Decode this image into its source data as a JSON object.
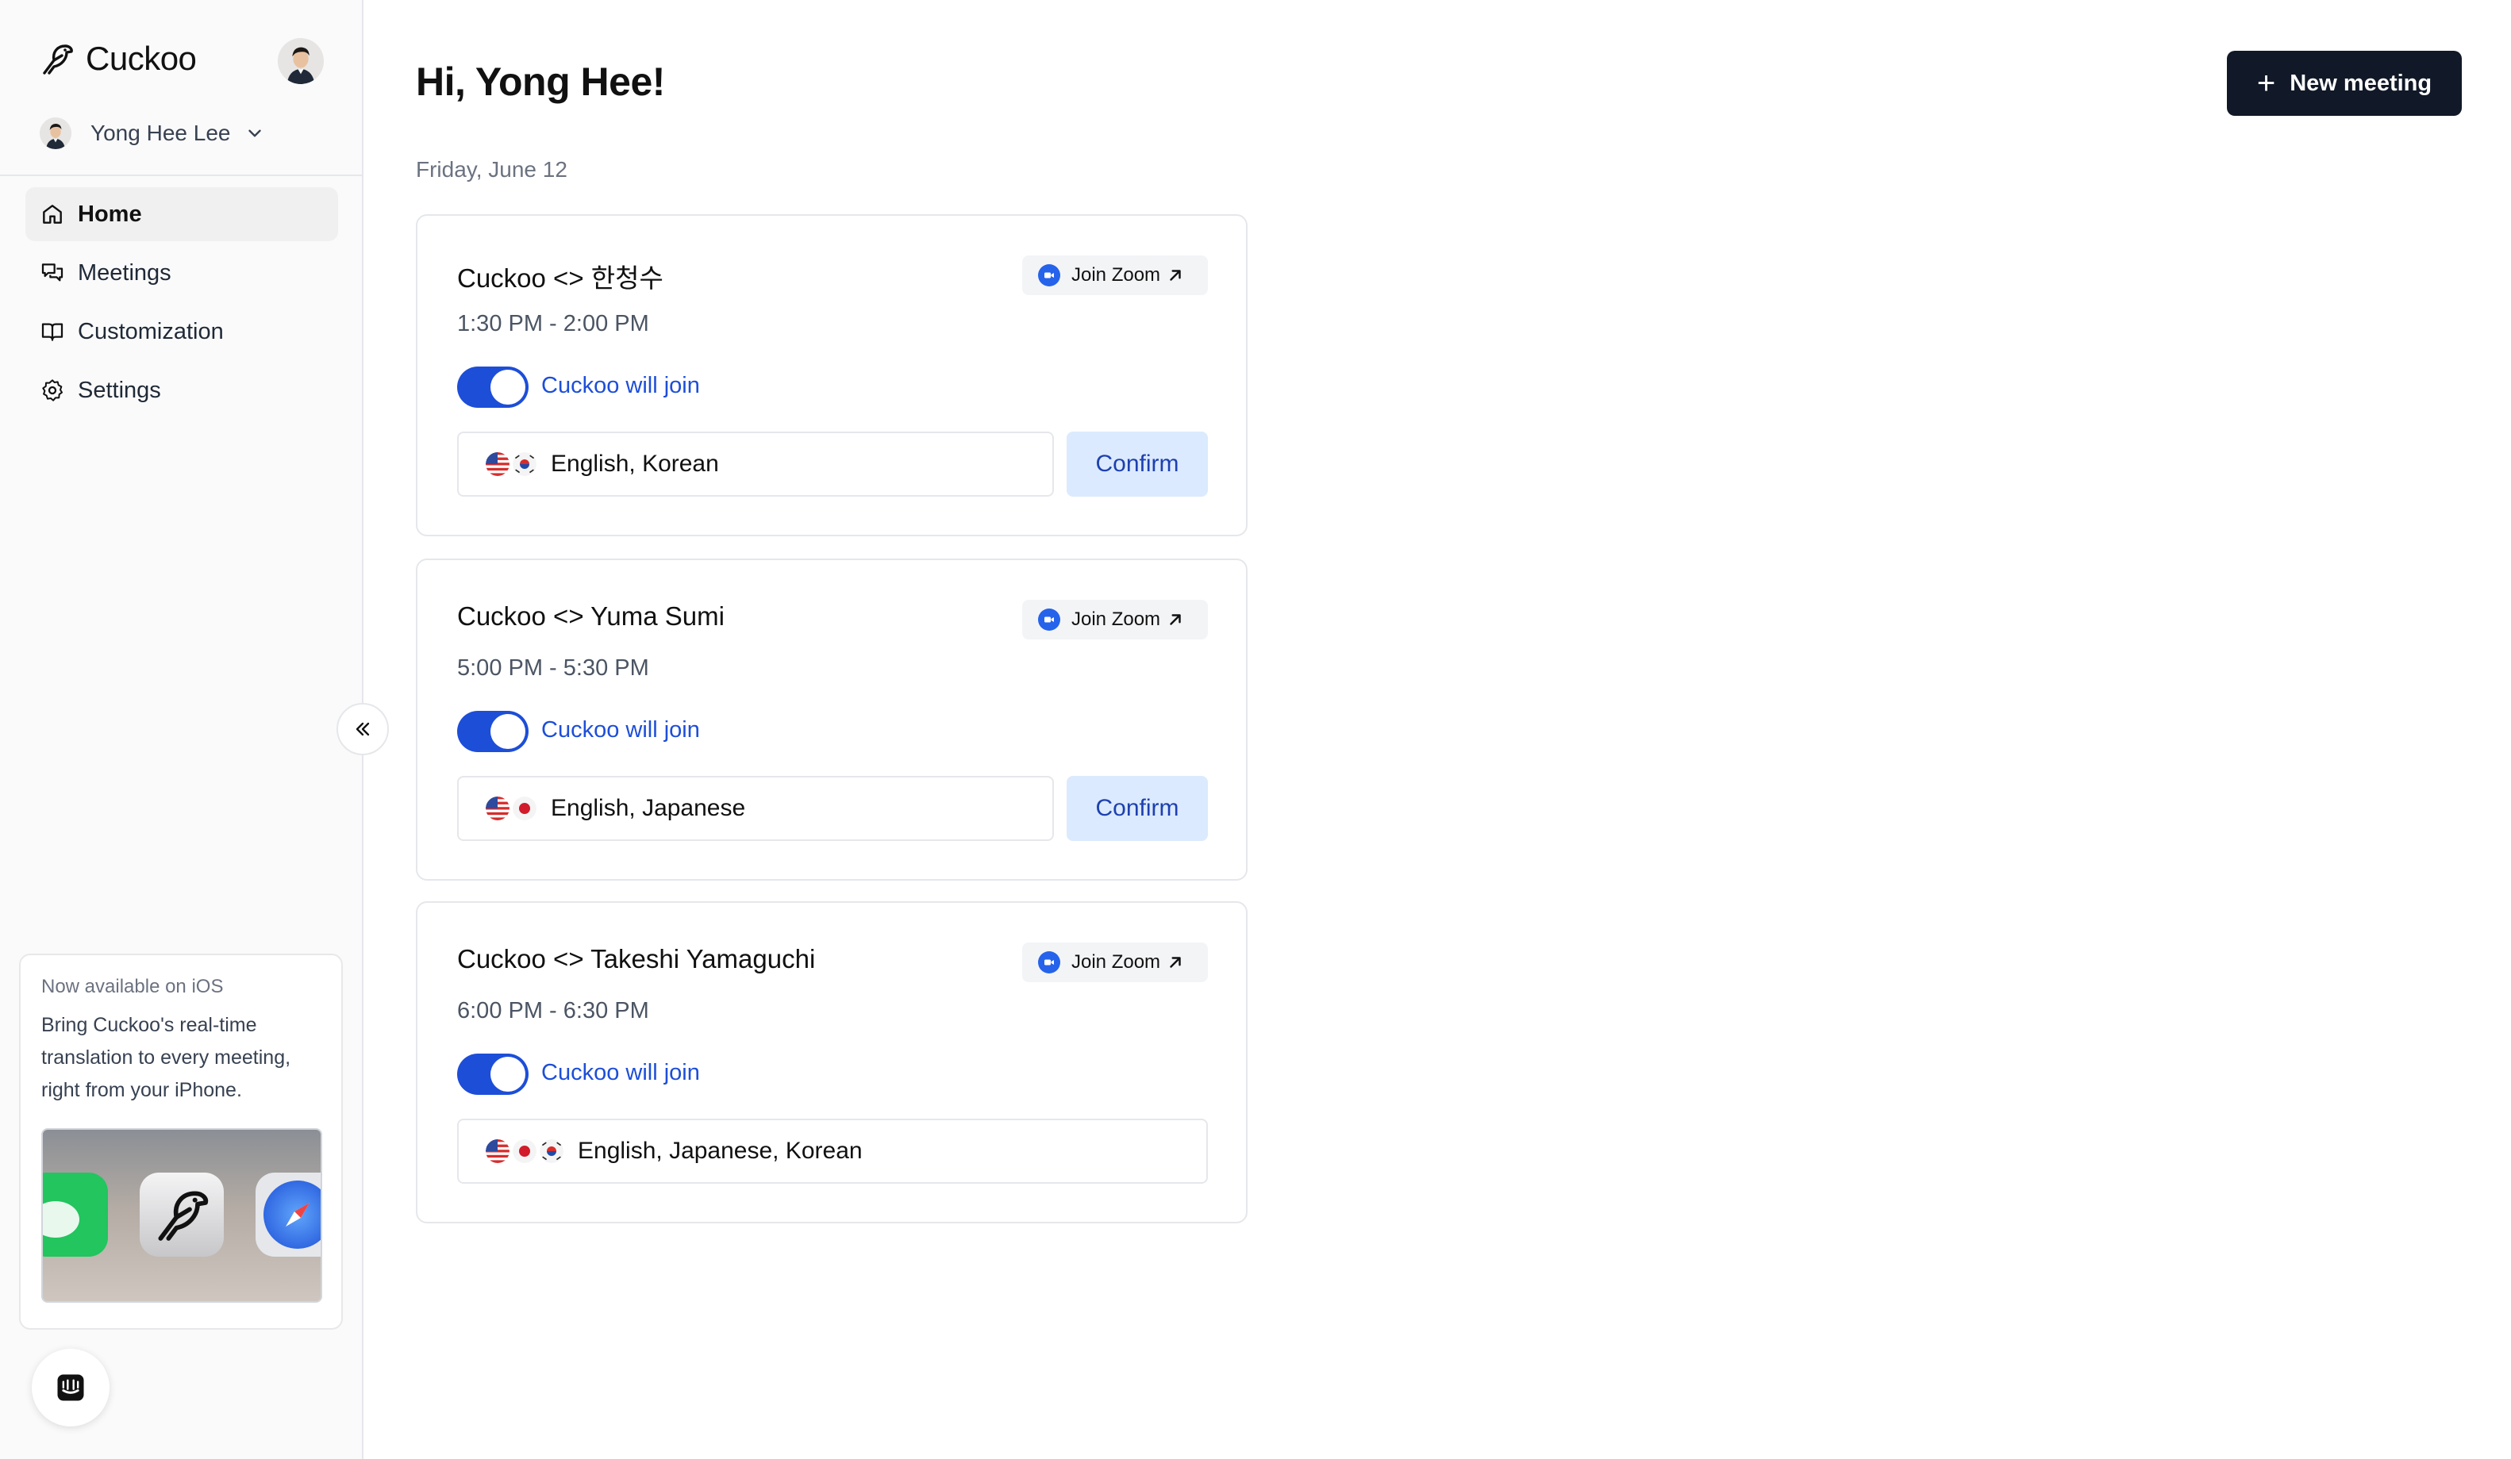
{
  "brand": {
    "name": "Cuckoo"
  },
  "user": {
    "name": "Yong Hee Lee"
  },
  "nav": [
    {
      "label": "Home",
      "icon": "home-icon",
      "active": true
    },
    {
      "label": "Meetings",
      "icon": "chat-bubbles-icon",
      "active": false
    },
    {
      "label": "Customization",
      "icon": "book-icon",
      "active": false
    },
    {
      "label": "Settings",
      "icon": "gear-icon",
      "active": false
    }
  ],
  "promo": {
    "title": "Now available on iOS",
    "body": "Bring Cuckoo's real-time translation to every meeting, right from your iPhone."
  },
  "main": {
    "greeting": "Hi, Yong Hee!",
    "new_meeting_label": "New meeting",
    "date": "Friday, June 12"
  },
  "meetings": [
    {
      "title": "Cuckoo <> 한청수",
      "time": "1:30 PM - 2:00 PM",
      "join_label": "Join Zoom",
      "toggle_label": "Cuckoo will join",
      "languages": "English, Korean",
      "flags": [
        "us",
        "kr"
      ],
      "confirm_label": "Confirm"
    },
    {
      "title": "Cuckoo <> Yuma Sumi",
      "time": "5:00 PM - 5:30 PM",
      "join_label": "Join Zoom",
      "toggle_label": "Cuckoo will join",
      "languages": "English, Japanese",
      "flags": [
        "us",
        "jp"
      ],
      "confirm_label": "Confirm"
    },
    {
      "title": "Cuckoo <> Takeshi Yamaguchi",
      "time": "6:00 PM - 6:30 PM",
      "join_label": "Join Zoom",
      "toggle_label": "Cuckoo will join",
      "languages": "English, Japanese, Korean",
      "flags": [
        "us",
        "jp",
        "kr"
      ]
    }
  ],
  "colors": {
    "accent": "#1d4ed8",
    "primary_button": "#111827",
    "confirm_bg": "#dbeafe",
    "sidebar_bg": "#fafafa"
  }
}
